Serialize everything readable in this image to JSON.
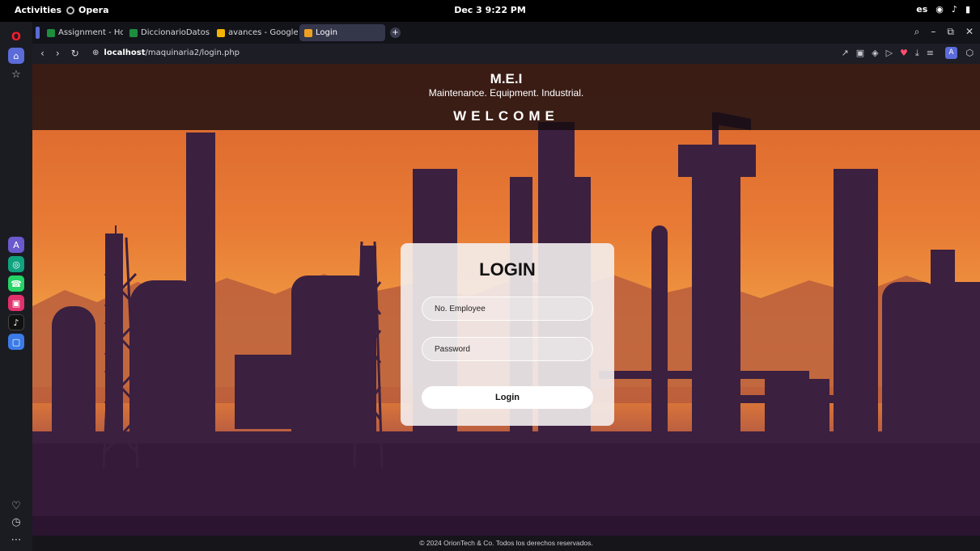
{
  "topbar": {
    "activities": "Activities",
    "app_name": "Opera",
    "clock": "Dec 3  9:22 PM",
    "language": "es"
  },
  "tabs": [
    {
      "label": "Assignment - Hojas",
      "favicon_color": "#1e8e3e"
    },
    {
      "label": "DiccionarioDatos.xls",
      "favicon_color": "#1e8e3e"
    },
    {
      "label": "avances - Google Dr",
      "favicon_color": "#f2b400"
    },
    {
      "label": "Login",
      "favicon_color": "#f0a020",
      "active": true
    }
  ],
  "addressbar": {
    "url_host": "localhost",
    "url_path": "/maquinaria2/login.php",
    "profile_letter": "A"
  },
  "header": {
    "brand": "M.E.I",
    "tagline": "Maintenance. Equipment. Industrial.",
    "welcome": "WELCOME"
  },
  "login": {
    "title": "LOGIN",
    "employee_placeholder": "No. Employee",
    "password_placeholder": "Password",
    "submit_label": "Login"
  },
  "footer": {
    "copyright": "© 2024 OrionTech & Co. Todos los derechos reservados."
  },
  "colors": {
    "sky_top": "#d9632c",
    "sky_mid": "#f09a43",
    "silhouette": "#3b2040",
    "header_bg": "#160c10"
  }
}
